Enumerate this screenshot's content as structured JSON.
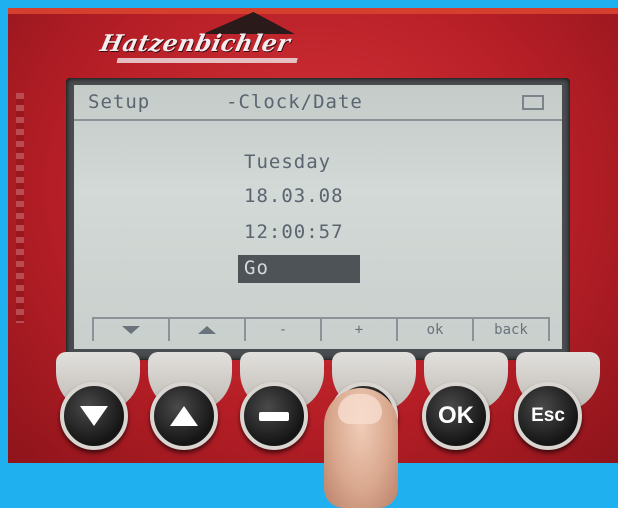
{
  "device": {
    "brand": "Hatzenbichler",
    "colors": {
      "body": "#b51e26",
      "lcd": "#cfd5d2",
      "lcd_text": "#5a6570",
      "background": "#1fb0f0"
    }
  },
  "screen": {
    "header": {
      "menu": "Setup",
      "title": "-Clock/Date"
    },
    "day": "Tuesday",
    "date": "18.03.08",
    "time": "12:00:57",
    "selected_option": "Go",
    "softkeys": [
      {
        "icon": "arrow-down-icon",
        "label": ""
      },
      {
        "icon": "arrow-up-icon",
        "label": ""
      },
      {
        "icon": "",
        "label": "-"
      },
      {
        "icon": "",
        "label": "+"
      },
      {
        "icon": "",
        "label": "ok"
      },
      {
        "icon": "",
        "label": "back"
      }
    ]
  },
  "hardware_keys": [
    {
      "name": "down",
      "icon": "arrow-down-icon",
      "label": ""
    },
    {
      "name": "up",
      "icon": "arrow-up-icon",
      "label": ""
    },
    {
      "name": "minus",
      "icon": "minus-icon",
      "label": ""
    },
    {
      "name": "plus",
      "icon": "plus-icon",
      "label": ""
    },
    {
      "name": "ok",
      "icon": "",
      "label": "OK"
    },
    {
      "name": "esc",
      "icon": "",
      "label": "Esc"
    }
  ]
}
